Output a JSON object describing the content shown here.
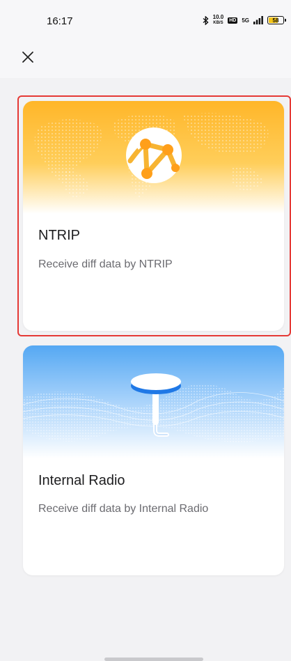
{
  "status_bar": {
    "time": "16:17",
    "speed_value": "10.0",
    "speed_unit": "KB/S",
    "hd_label": "HD",
    "network_label": "5G",
    "battery_level": "58"
  },
  "header": {
    "close_icon": "close-icon"
  },
  "options": [
    {
      "title": "NTRIP",
      "description": "Receive diff data by NTRIP",
      "selected": true,
      "icon": "network-globe-icon"
    },
    {
      "title": "Internal Radio",
      "description": "Receive diff data by Internal Radio",
      "selected": false,
      "icon": "radio-antenna-icon"
    }
  ],
  "colors": {
    "ntrip_gradient_top": "#ffb629",
    "ntrip_node": "#ff9f1a",
    "radio_gradient_top": "#55a8f3",
    "radio_accent": "#1f78e6",
    "selection_outline": "#e53935"
  }
}
